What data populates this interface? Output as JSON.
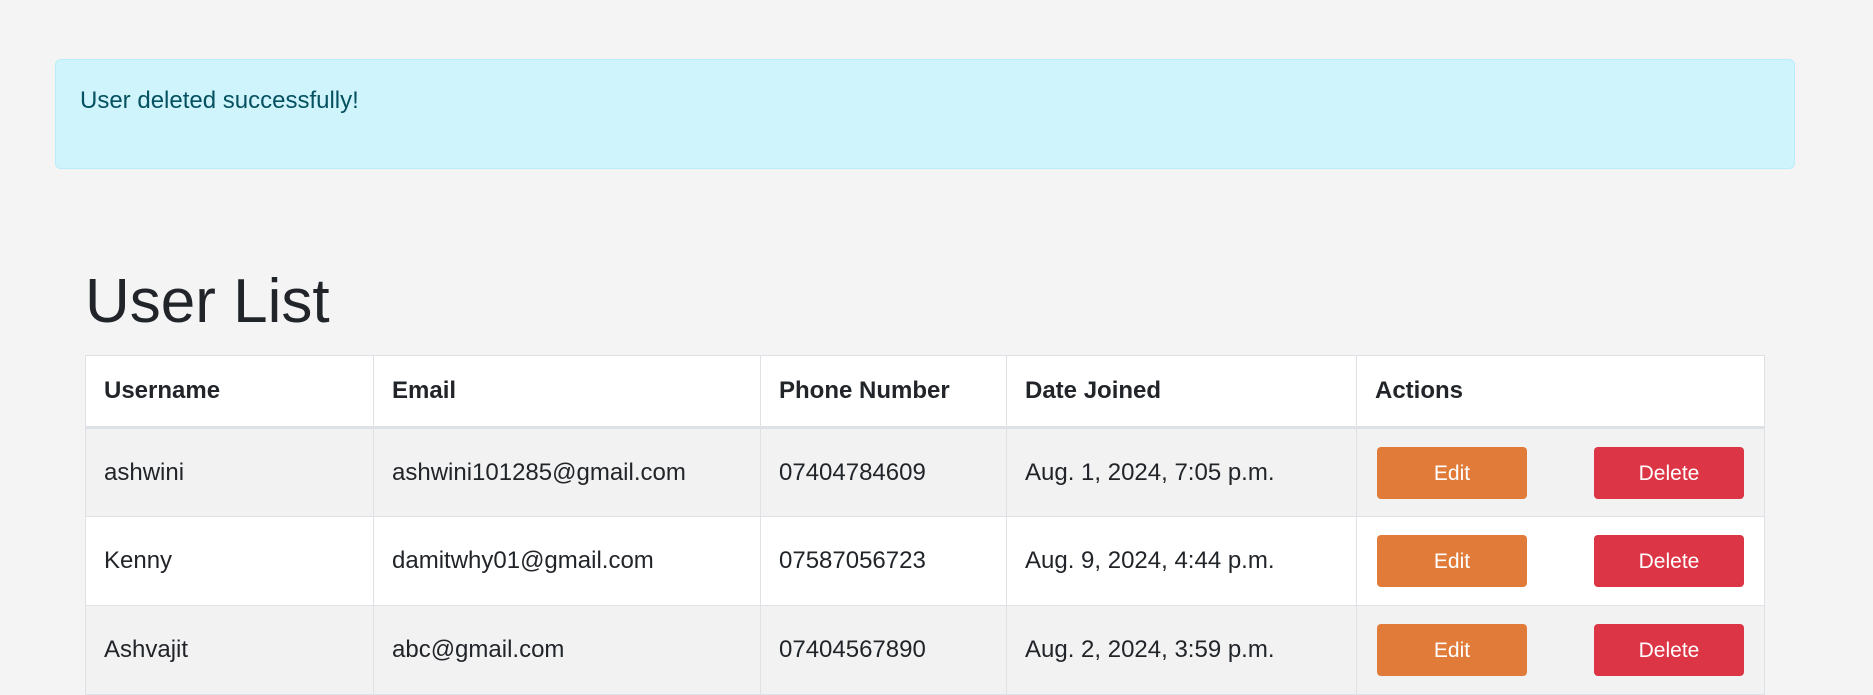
{
  "alert": {
    "message": "User deleted successfully!"
  },
  "page": {
    "title": "User List"
  },
  "table": {
    "headers": {
      "username": "Username",
      "email": "Email",
      "phone": "Phone Number",
      "date_joined": "Date Joined",
      "actions": "Actions"
    },
    "rows": [
      {
        "username": "ashwini",
        "email": "ashwini101285@gmail.com",
        "phone": "07404784609",
        "date_joined": "Aug. 1, 2024, 7:05 p.m.",
        "edit_label": "Edit",
        "delete_label": "Delete"
      },
      {
        "username": "Kenny",
        "email": "damitwhy01@gmail.com",
        "phone": "07587056723",
        "date_joined": "Aug. 9, 2024, 4:44 p.m.",
        "edit_label": "Edit",
        "delete_label": "Delete"
      },
      {
        "username": "Ashvajit",
        "email": "abc@gmail.com",
        "phone": "07404567890",
        "date_joined": "Aug. 2, 2024, 3:59 p.m.",
        "edit_label": "Edit",
        "delete_label": "Delete"
      }
    ]
  },
  "colors": {
    "alert_bg": "#cff4fc",
    "alert_text": "#055160",
    "edit_button": "#e07b39",
    "delete_button": "#dc3545",
    "page_bg": "#f4f4f4"
  }
}
